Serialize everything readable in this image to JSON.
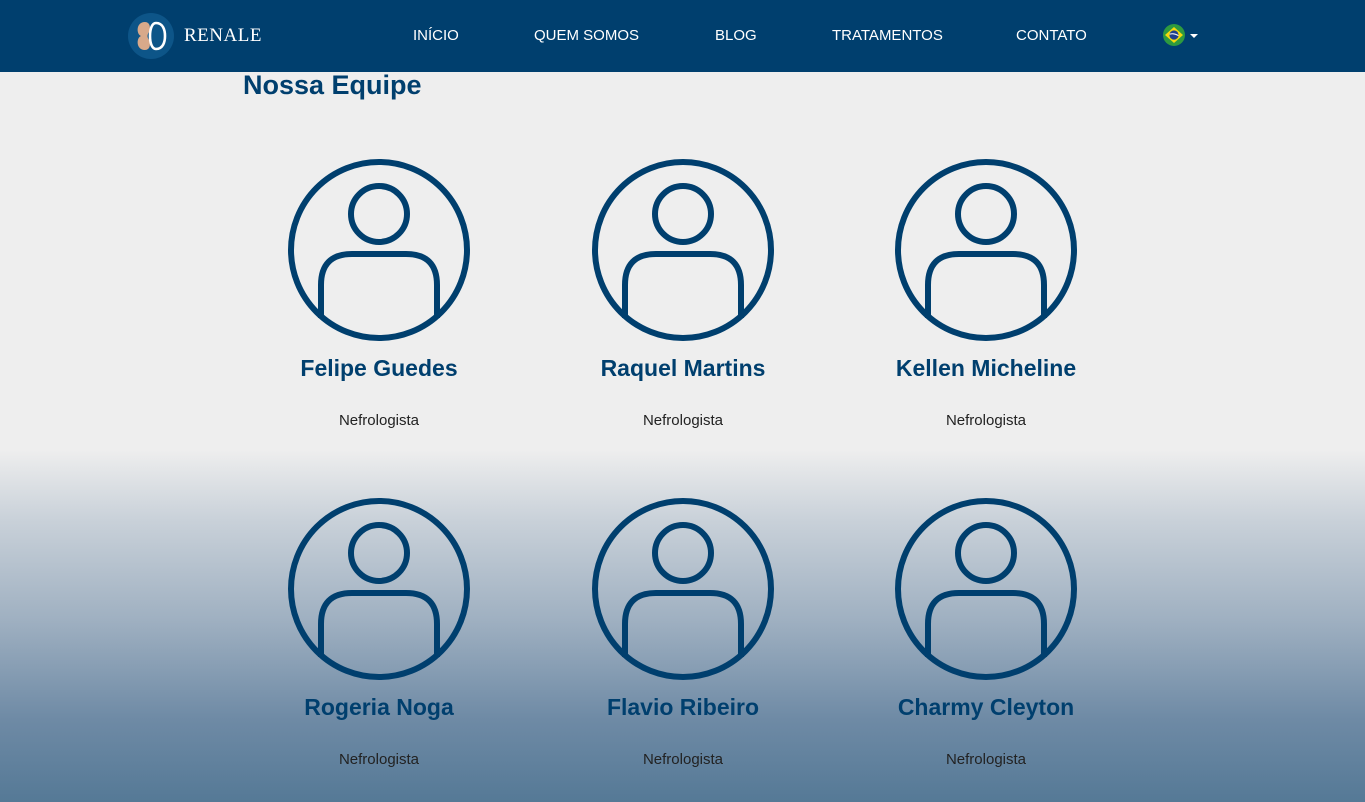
{
  "brand": {
    "name": "RENALE"
  },
  "nav": {
    "items": [
      {
        "label": "INÍCIO"
      },
      {
        "label": "QUEM SOMOS"
      },
      {
        "label": "BLOG"
      },
      {
        "label": "TRATAMENTOS"
      },
      {
        "label": "CONTATO"
      }
    ],
    "language_icon": "brazil-flag-icon"
  },
  "page": {
    "title": "Nossa Equipe"
  },
  "team": [
    {
      "name": "Felipe Guedes",
      "role": "Nefrologista"
    },
    {
      "name": "Raquel Martins",
      "role": "Nefrologista"
    },
    {
      "name": "Kellen Micheline",
      "role": "Nefrologista"
    },
    {
      "name": "Rogeria Noga",
      "role": "Nefrologista"
    },
    {
      "name": "Flavio Ribeiro",
      "role": "Nefrologista"
    },
    {
      "name": "Charmy Cleyton",
      "role": "Nefrologista"
    }
  ],
  "colors": {
    "primary": "#003f6e",
    "background": "#eeeeee",
    "kidney": "#d8a98a"
  }
}
